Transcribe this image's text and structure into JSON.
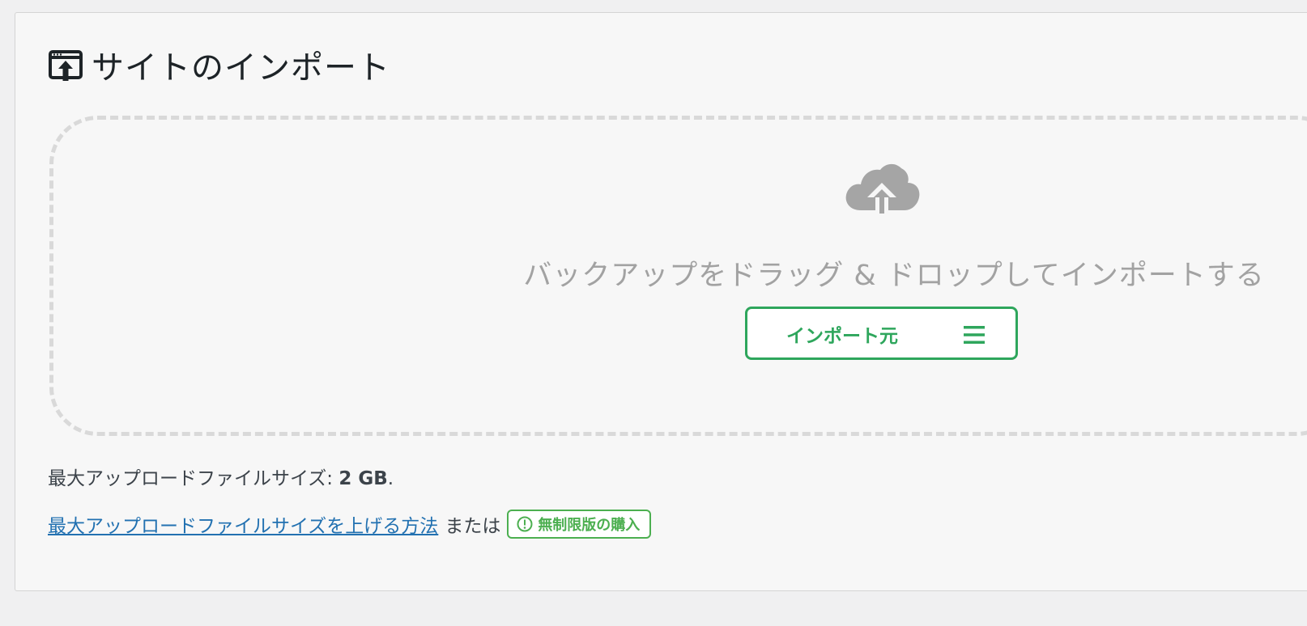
{
  "header": {
    "title": "サイトのインポート",
    "title_icon": "import-site-icon"
  },
  "dropzone": {
    "icon": "cloud-upload-icon",
    "text": "バックアップをドラッグ & ドロップしてインポートする",
    "import_button_label": "インポート元",
    "menu_icon": "hamburger-menu-icon"
  },
  "info": {
    "max_size_label": "最大アップロードファイルサイズ: ",
    "max_size_value": "2 GB",
    "max_size_suffix": ".",
    "help_link": "最大アップロードファイルサイズを上げる方法",
    "or_text": "または",
    "buy_button_label": "無制限版の購入",
    "buy_icon": "info-icon"
  },
  "colors": {
    "accent_green": "#2ea65c",
    "link_blue": "#2271b1",
    "muted_text": "#a2a2a2"
  }
}
